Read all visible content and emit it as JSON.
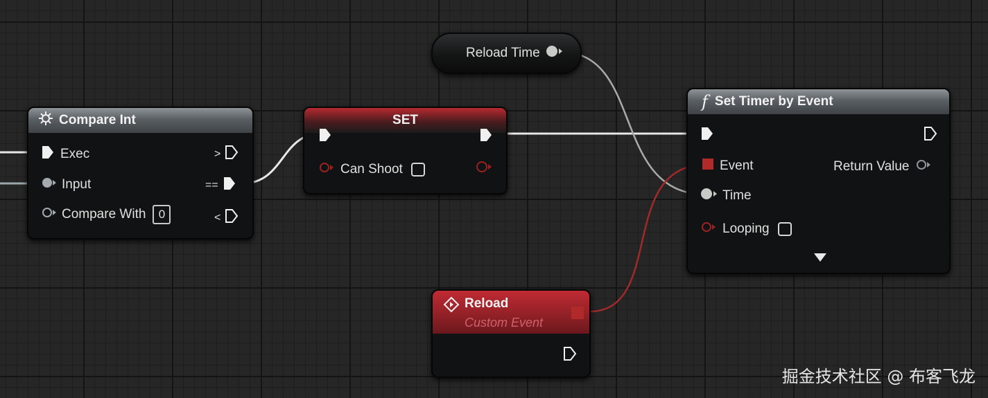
{
  "nodes": {
    "compare_int": {
      "title": "Compare Int",
      "exec_label": "Exec",
      "input_label": "Input",
      "compare_with_label": "Compare With",
      "compare_with_value": "0",
      "out_greater": ">",
      "out_equal": "==",
      "out_less": "<"
    },
    "set": {
      "title": "SET",
      "can_shoot_label": "Can Shoot"
    },
    "reload_time": {
      "label": "Reload Time"
    },
    "set_timer": {
      "title": "Set Timer by Event",
      "function_glyph": "f",
      "event_label": "Event",
      "time_label": "Time",
      "looping_label": "Looping",
      "return_label": "Return Value"
    },
    "reload_event": {
      "title": "Reload",
      "subtitle": "Custom Event"
    }
  },
  "watermark": "掘金技术社区 @ 布客飞龙",
  "colors": {
    "exec_wire": "#ffffff",
    "float_wire": "#a8aba8",
    "delegate_wire": "#a02a2a",
    "bool_pin": "#8c1d1d",
    "delegate_pin": "#b02a2a"
  }
}
